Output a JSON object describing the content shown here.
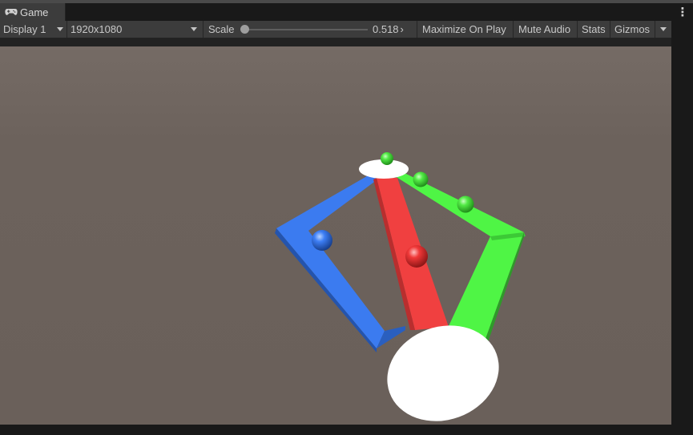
{
  "window": {
    "tab_label": "Game",
    "tab_icon": "gamepad-icon",
    "menu_icon": "kebab-menu-icon"
  },
  "toolbar": {
    "display": "Display 1",
    "resolution": "1920x1080",
    "scale_label": "Scale",
    "scale_value": "0.518",
    "scale_suffix": "›",
    "maximize_on_play": "Maximize On Play",
    "mute_audio": "Mute Audio",
    "stats": "Stats",
    "gizmos": "Gizmos"
  },
  "scene": {
    "background_color": "#6c625c",
    "colors": {
      "blue": "#3d7ef5",
      "red": "#f04040",
      "green": "#4ff545",
      "white": "#ffffff"
    }
  }
}
